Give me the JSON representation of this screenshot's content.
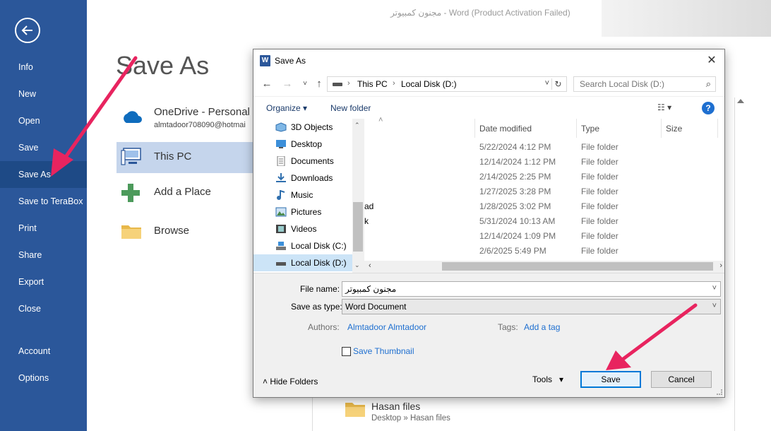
{
  "window": {
    "title": "مجنون كمبيوتر - Word (Product Activation Failed)"
  },
  "backstage": {
    "heading": "Save As",
    "nav": [
      {
        "label": "Info"
      },
      {
        "label": "New"
      },
      {
        "label": "Open"
      },
      {
        "label": "Save"
      },
      {
        "label": "Save As",
        "active": true
      },
      {
        "label": "Save to TeraBox"
      },
      {
        "label": "Print"
      },
      {
        "label": "Share"
      },
      {
        "label": "Export"
      },
      {
        "label": "Close"
      },
      {
        "label": "Account"
      },
      {
        "label": "Options"
      }
    ],
    "locations": {
      "onedrive_name": "OneDrive - Personal",
      "onedrive_email": "almtadoor708090@hotmai",
      "this_pc": "This PC",
      "add_place": "Add a Place",
      "browse": "Browse"
    },
    "recent": {
      "name": "Hasan files",
      "path": "Desktop » Hasan files"
    },
    "colors": {
      "rail": "#2b579a",
      "rail_active": "#1e4a86",
      "selected_location": "#c5d5ec",
      "annotation_arrow": "#e8245f"
    }
  },
  "dialog": {
    "title": "Save As",
    "close_glyph": "✕",
    "address": {
      "segments": [
        "This PC",
        "Local Disk (D:)"
      ],
      "separator": "›"
    },
    "search_placeholder": "Search Local Disk (D:)",
    "toolbar": {
      "organize": "Organize ▾",
      "new_folder": "New folder",
      "view_glyph": "☷ ▾",
      "help_glyph": "?"
    },
    "tree": [
      {
        "label": "3D Objects",
        "icon": "3d-objects-icon"
      },
      {
        "label": "Desktop",
        "icon": "desktop-icon"
      },
      {
        "label": "Documents",
        "icon": "documents-icon"
      },
      {
        "label": "Downloads",
        "icon": "downloads-icon"
      },
      {
        "label": "Music",
        "icon": "music-icon"
      },
      {
        "label": "Pictures",
        "icon": "pictures-icon"
      },
      {
        "label": "Videos",
        "icon": "videos-icon"
      },
      {
        "label": "Local Disk (C:)",
        "icon": "drive-icon"
      },
      {
        "label": "Local Disk (D:)",
        "icon": "drive-icon",
        "selected": true
      }
    ],
    "columns": {
      "date": "Date modified",
      "type": "Type",
      "size": "Size"
    },
    "files": [
      {
        "name": "",
        "date": "5/22/2024 4:12 PM",
        "type": "File folder"
      },
      {
        "name": "",
        "date": "12/14/2024 1:12 PM",
        "type": "File folder"
      },
      {
        "name": "",
        "date": "2/14/2025 2:25 PM",
        "type": "File folder"
      },
      {
        "name": "",
        "date": "1/27/2025 3:28 PM",
        "type": "File folder"
      },
      {
        "name": "ad",
        "date": "1/28/2025 3:02 PM",
        "type": "File folder"
      },
      {
        "name": "k",
        "date": "5/31/2024 10:13 AM",
        "type": "File folder"
      },
      {
        "name": "",
        "date": "12/14/2024 1:09 PM",
        "type": "File folder"
      },
      {
        "name": "",
        "date": "2/6/2025 5:49 PM",
        "type": "File folder"
      }
    ],
    "form": {
      "file_name_label": "File name:",
      "file_name_value": "مجنون كمبيوتر",
      "save_type_label": "Save as type:",
      "save_type_value": "Word Document",
      "authors_label": "Authors:",
      "authors_value": "Almtadoor Almtadoor",
      "tags_label": "Tags:",
      "tags_value": "Add a tag",
      "thumbnail_label": "Save Thumbnail"
    },
    "footer": {
      "hide_folders": "Hide Folders",
      "tools": "Tools",
      "save": "Save",
      "cancel": "Cancel"
    }
  }
}
